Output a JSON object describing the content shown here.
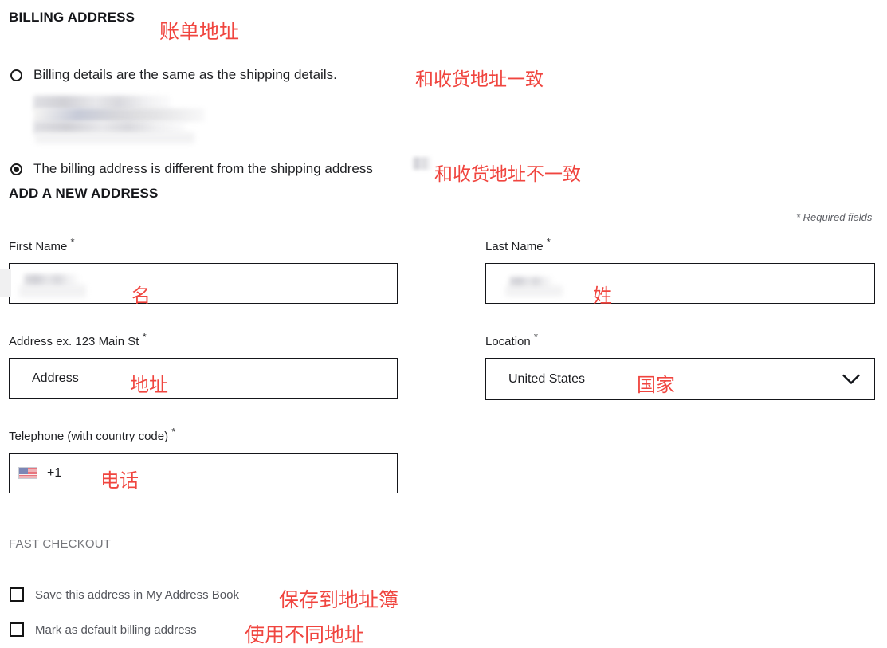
{
  "headings": {
    "billing_address": "BILLING ADDRESS",
    "add_new_address": "ADD A NEW ADDRESS",
    "fast_checkout": "FAST CHECKOUT"
  },
  "annotations": {
    "billing_address": "账单地址",
    "same_as_shipping": "和收货地址一致",
    "different_from_shipping": "和收货地址不一致",
    "first_name": "名",
    "last_name": "姓",
    "address": "地址",
    "location": "国家",
    "telephone": "电话",
    "save_address": "保存到地址簿",
    "default_billing": "使用不同地址",
    "color": "#f0453f"
  },
  "radios": [
    {
      "label": "Billing details are the same as the shipping details.",
      "checked": false
    },
    {
      "label": "The billing address is different from the shipping address",
      "checked": true
    }
  ],
  "required_note": "* Required fields",
  "fields": {
    "first_name": {
      "label": "First Name",
      "required_mark": "*",
      "value": "",
      "redacted": true
    },
    "last_name": {
      "label": "Last Name",
      "required_mark": "*",
      "value": "",
      "redacted": true
    },
    "address": {
      "label": "Address ex. 123 Main St",
      "required_mark": "*",
      "value": "Address"
    },
    "location": {
      "label": "Location",
      "required_mark": "*",
      "value": "United States",
      "icon": "chevron-down-icon"
    },
    "telephone": {
      "label": "Telephone (with country code)",
      "required_mark": "*",
      "value": "+1",
      "flag": "us-flag-icon"
    }
  },
  "checkboxes": [
    {
      "label": "Save this address in My Address Book",
      "checked": false
    },
    {
      "label": "Mark as default billing address",
      "checked": false
    }
  ]
}
